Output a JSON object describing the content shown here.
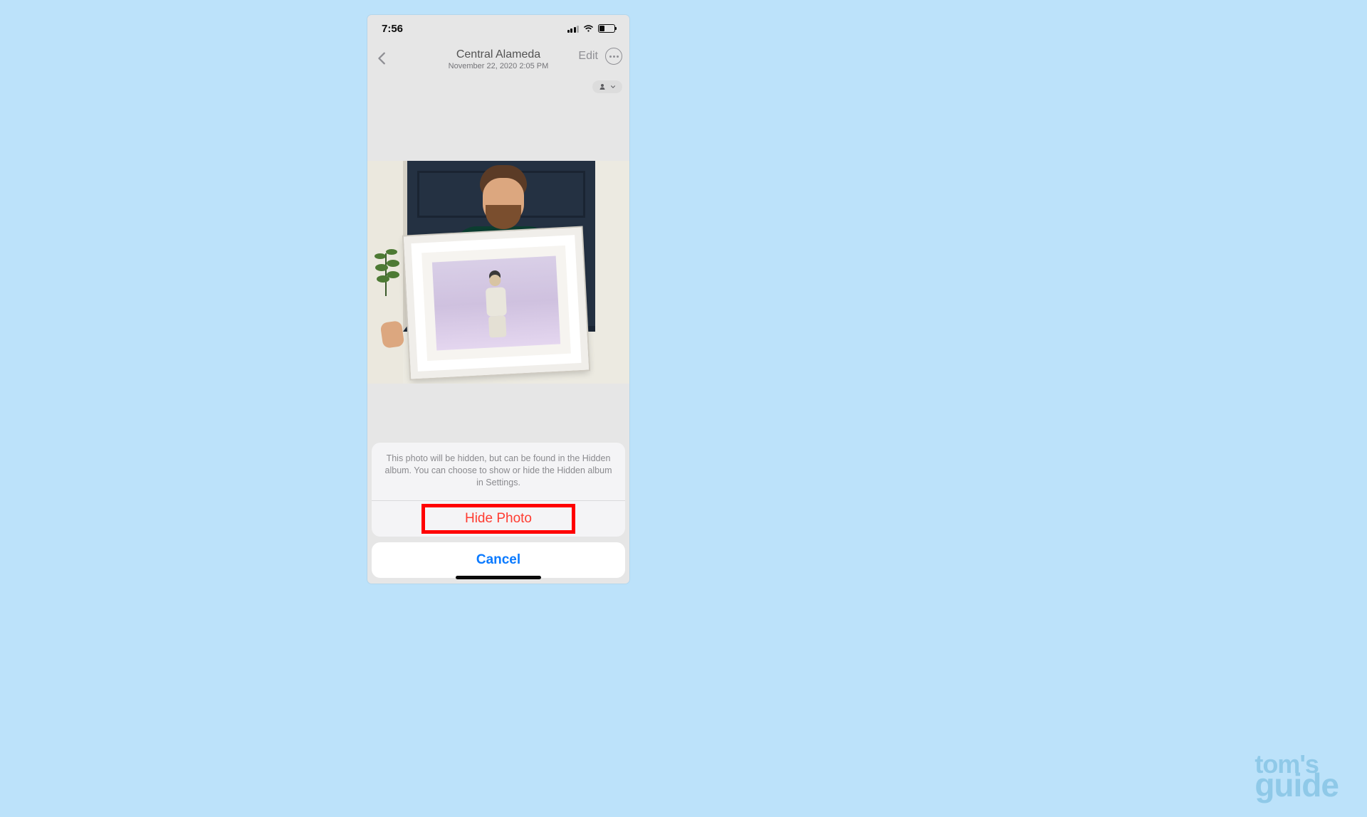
{
  "statusbar": {
    "time": "7:56"
  },
  "nav": {
    "title": "Central Alameda",
    "subtitle": "November 22, 2020  2:05 PM",
    "edit_label": "Edit"
  },
  "actionsheet": {
    "message": "This photo will be hidden, but can be found in the Hidden album. You can choose to show or hide the Hidden album in Settings.",
    "hide_label": "Hide Photo",
    "cancel_label": "Cancel"
  },
  "watermark": {
    "line1": "tom's",
    "line2": "guide"
  },
  "colors": {
    "page_bg": "#bce2fa",
    "ios_red": "#ff3b30",
    "ios_blue": "#0a7aff",
    "highlight": "#ff0000"
  }
}
